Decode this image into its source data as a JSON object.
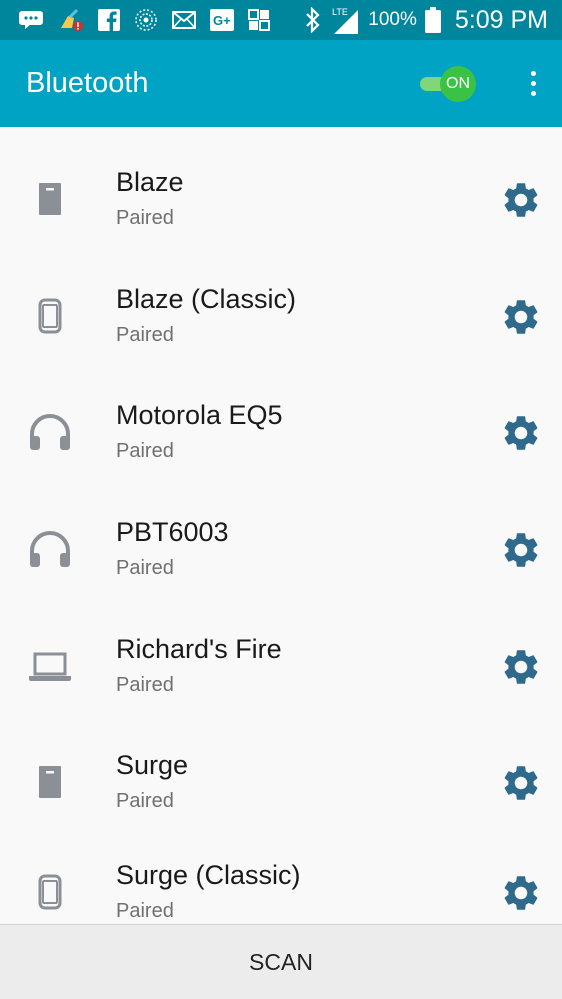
{
  "status_bar": {
    "battery": "100%",
    "network": "LTE",
    "time": "5:09 PM",
    "icons": [
      "chat-bubble-icon",
      "cleaner-icon",
      "facebook-icon",
      "sunburst-icon",
      "mail-icon",
      "google-plus-icon",
      "app-icon",
      "bluetooth-icon",
      "signal-icon",
      "battery-icon"
    ]
  },
  "app_bar": {
    "title": "Bluetooth",
    "toggle_label": "ON",
    "toggle_on": true
  },
  "devices": [
    {
      "name": "Blaze",
      "status": "Paired",
      "icon": "phone-icon"
    },
    {
      "name": "Blaze (Classic)",
      "status": "Paired",
      "icon": "watch-icon"
    },
    {
      "name": "Motorola EQ5",
      "status": "Paired",
      "icon": "headphones-icon"
    },
    {
      "name": "PBT6003",
      "status": "Paired",
      "icon": "headphones-icon"
    },
    {
      "name": "Richard's Fire",
      "status": "Paired",
      "icon": "laptop-icon"
    },
    {
      "name": "Surge",
      "status": "Paired",
      "icon": "phone-icon"
    },
    {
      "name": "Surge (Classic)",
      "status": "Paired",
      "icon": "watch-icon"
    }
  ],
  "scan_button": {
    "label": "SCAN"
  },
  "colors": {
    "status_bar": "#00869c",
    "app_bar": "#00a3c4",
    "toggle_thumb": "#3ac244",
    "gear": "#2f6a8c",
    "device_icon": "#8a9096"
  }
}
